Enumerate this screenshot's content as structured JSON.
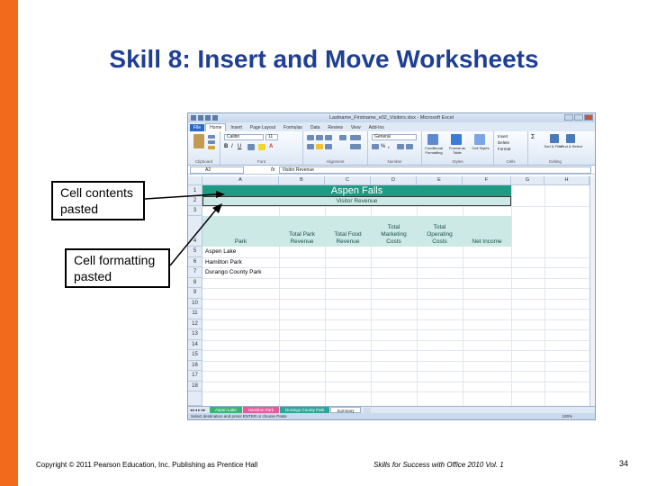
{
  "slide": {
    "title": "Skill 8: Insert and Move Worksheets",
    "callout_contents": "Cell contents pasted",
    "callout_formatting": "Cell formatting pasted",
    "copyright": "Copyright © 2011 Pearson Education, Inc. Publishing as Prentice Hall",
    "book": "Skills for Success with Office 2010 Vol. 1",
    "page_number": "34",
    "accent_color": "#f26b1d",
    "title_color": "#1f3f95"
  },
  "excel": {
    "window_title": "Lastname_Firstname_e02_Visitors.xlsx - Microsoft Excel",
    "tabs": [
      "File",
      "Home",
      "Insert",
      "Page Layout",
      "Formulas",
      "Data",
      "Review",
      "View",
      "Add-Ins"
    ],
    "ribbon_groups": [
      "Clipboard",
      "Font",
      "Alignment",
      "Number",
      "Styles",
      "Cells",
      "Editing"
    ],
    "font_name": "Calibri",
    "font_size": "11",
    "number_format": "General",
    "style_buttons": [
      "Conditional Formatting",
      "Format as Table",
      "Cell Styles"
    ],
    "cells_buttons": [
      "Insert",
      "Delete",
      "Format"
    ],
    "editing_buttons": [
      "Sort & Filter",
      "Find & Select"
    ],
    "name_box": "A2",
    "fx_symbol": "fx",
    "formula_value": "Visitor Revenue",
    "columns": [
      "A",
      "B",
      "C",
      "D",
      "E",
      "F",
      "G",
      "H"
    ],
    "rows": [
      "1",
      "2",
      "3",
      "4",
      "5",
      "6",
      "7",
      "8",
      "9",
      "10",
      "11",
      "12",
      "13",
      "14",
      "15",
      "16",
      "17",
      "18"
    ],
    "a1_title": "Aspen Falls",
    "a2_subtitle": "Visitor Revenue",
    "headers": {
      "park": "Park",
      "total_park_1": "Total Park",
      "total_park_2": "Revenue",
      "total_food_1": "Total Food",
      "total_food_2": "Revenue",
      "total_marketing_0": "Total",
      "total_marketing_1": "Marketing",
      "total_marketing_2": "Costs",
      "total_operating_0": "Total",
      "total_operating_1": "Operating",
      "total_operating_2": "Costs",
      "net_income": "Net Income"
    },
    "parks": [
      "Aspen Lake",
      "Hamilton Park",
      "Durango County Park"
    ],
    "sheet_tabs": [
      "Aspen Lake",
      "Hamilton Park",
      "Durango County Park",
      "Summary"
    ],
    "status_text": "Select destination and press ENTER or choose Paste",
    "zoom": "100%",
    "colors": {
      "band": "#1f9a83",
      "band_light": "#cde9e6"
    }
  }
}
